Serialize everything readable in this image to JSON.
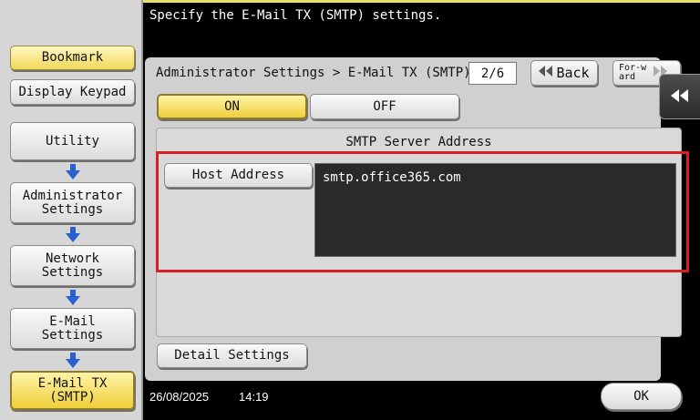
{
  "header": {
    "message": "Specify the E-Mail TX (SMTP) settings."
  },
  "left_panel": {
    "bookmark_label": "Bookmark",
    "display_keypad_label": "Display Keypad",
    "breadcrumb_items": [
      {
        "label": "Utility"
      },
      {
        "label": "Administrator Settings"
      },
      {
        "label": "Network Settings"
      },
      {
        "label": "E-Mail Settings"
      },
      {
        "label": "E-Mail TX (SMTP)"
      }
    ]
  },
  "titlebar": {
    "path": "Administrator Settings > E-Mail TX (SMTP)",
    "page": "2/6",
    "back_label": "Back",
    "forward_label": "For-ward"
  },
  "toggle": {
    "on_label": "ON",
    "off_label": "OFF",
    "selected": "ON"
  },
  "smtp": {
    "section_title": "SMTP Server Address",
    "host_button_label": "Host Address",
    "host_value": "smtp.office365.com"
  },
  "detail_settings_label": "Detail Settings",
  "footer": {
    "date": "26/08/2025",
    "time": "14:19",
    "ok_label": "OK"
  },
  "colors": {
    "highlight_border": "#d61e24",
    "selected_yellow": "#f0cf3a"
  },
  "icons": {
    "back": "double-left-arrow-icon",
    "forward": "double-right-arrow-icon",
    "collapse": "double-left-chevron-icon",
    "breadcrumb_arrow": "arrow-down-icon"
  }
}
